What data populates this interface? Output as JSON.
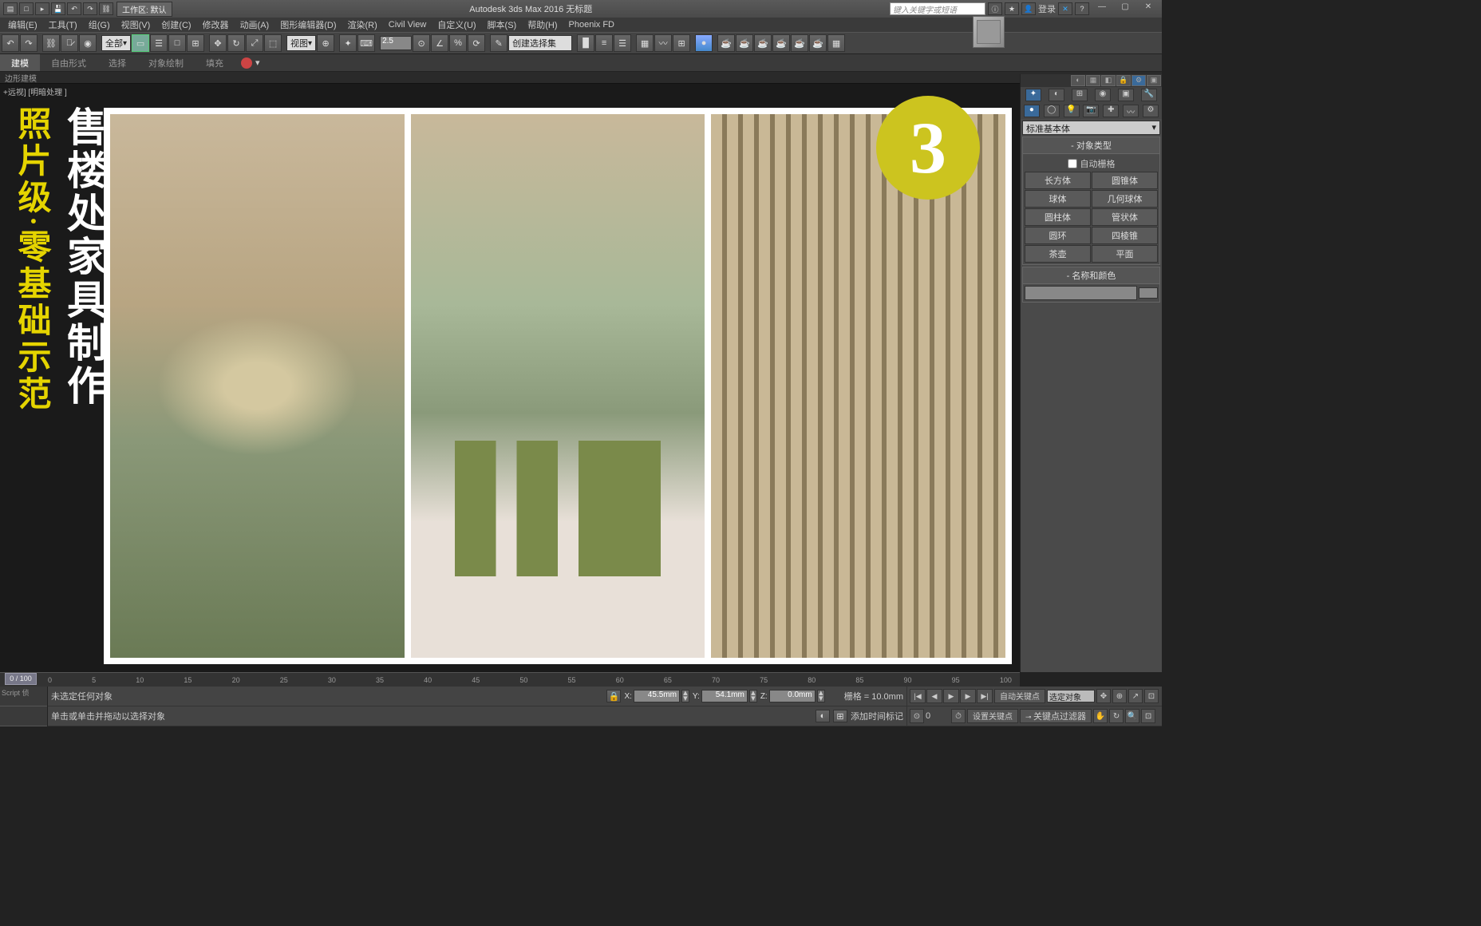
{
  "titlebar": {
    "workspace_label": "工作区: 默认",
    "app_title": "Autodesk 3ds Max 2016   无标题",
    "search_placeholder": "键入关键字或短语",
    "login": "登录"
  },
  "menus": [
    "编辑(E)",
    "工具(T)",
    "组(G)",
    "视图(V)",
    "创建(C)",
    "修改器",
    "动画(A)",
    "图形编辑器(D)",
    "渲染(R)",
    "Civil View",
    "自定义(U)",
    "脚本(S)",
    "帮助(H)",
    "Phoenix FD"
  ],
  "toolbar": {
    "filter": "全部",
    "viewlabel": "视图",
    "numeric": "2.5",
    "selset": "创建选择集"
  },
  "ribbon": {
    "tabs": [
      "建模",
      "自由形式",
      "选择",
      "对象绘制",
      "填充"
    ],
    "sub": "边形建模"
  },
  "viewport": {
    "label": "+远视] [明暗处理 ]",
    "promo_white": "售楼处家具制作",
    "promo_yellow1": "照片级",
    "promo_dot": "·",
    "promo_yellow2": "零基础示范",
    "badge": "3"
  },
  "rpanel": {
    "category": "标准基本体",
    "sec1": "对象类型",
    "autogrid": "自动栅格",
    "prims": [
      "长方体",
      "圆锥体",
      "球体",
      "几何球体",
      "圆柱体",
      "管状体",
      "圆环",
      "四棱锥",
      "茶壶",
      "平面"
    ],
    "sec2": "名称和颜色"
  },
  "timeline": {
    "cursor": "0 / 100",
    "ticks": [
      "0",
      "5",
      "10",
      "15",
      "20",
      "25",
      "30",
      "35",
      "40",
      "45",
      "50",
      "55",
      "60",
      "65",
      "70",
      "75",
      "80",
      "85",
      "90",
      "95",
      "100"
    ]
  },
  "status": {
    "script_label": "Script 侦",
    "line1": "未选定任何对象",
    "line2": "单击或单击并拖动以选择对象",
    "x": "45.5mm",
    "y": "54.1mm",
    "z": "0.0mm",
    "grid": "栅格 = 10.0mm",
    "addtime": "添加时间标记",
    "autokey": "自动关键点",
    "setkey": "设置关键点",
    "selobj": "选定对象",
    "keyfilter": "关键点过滤器"
  }
}
